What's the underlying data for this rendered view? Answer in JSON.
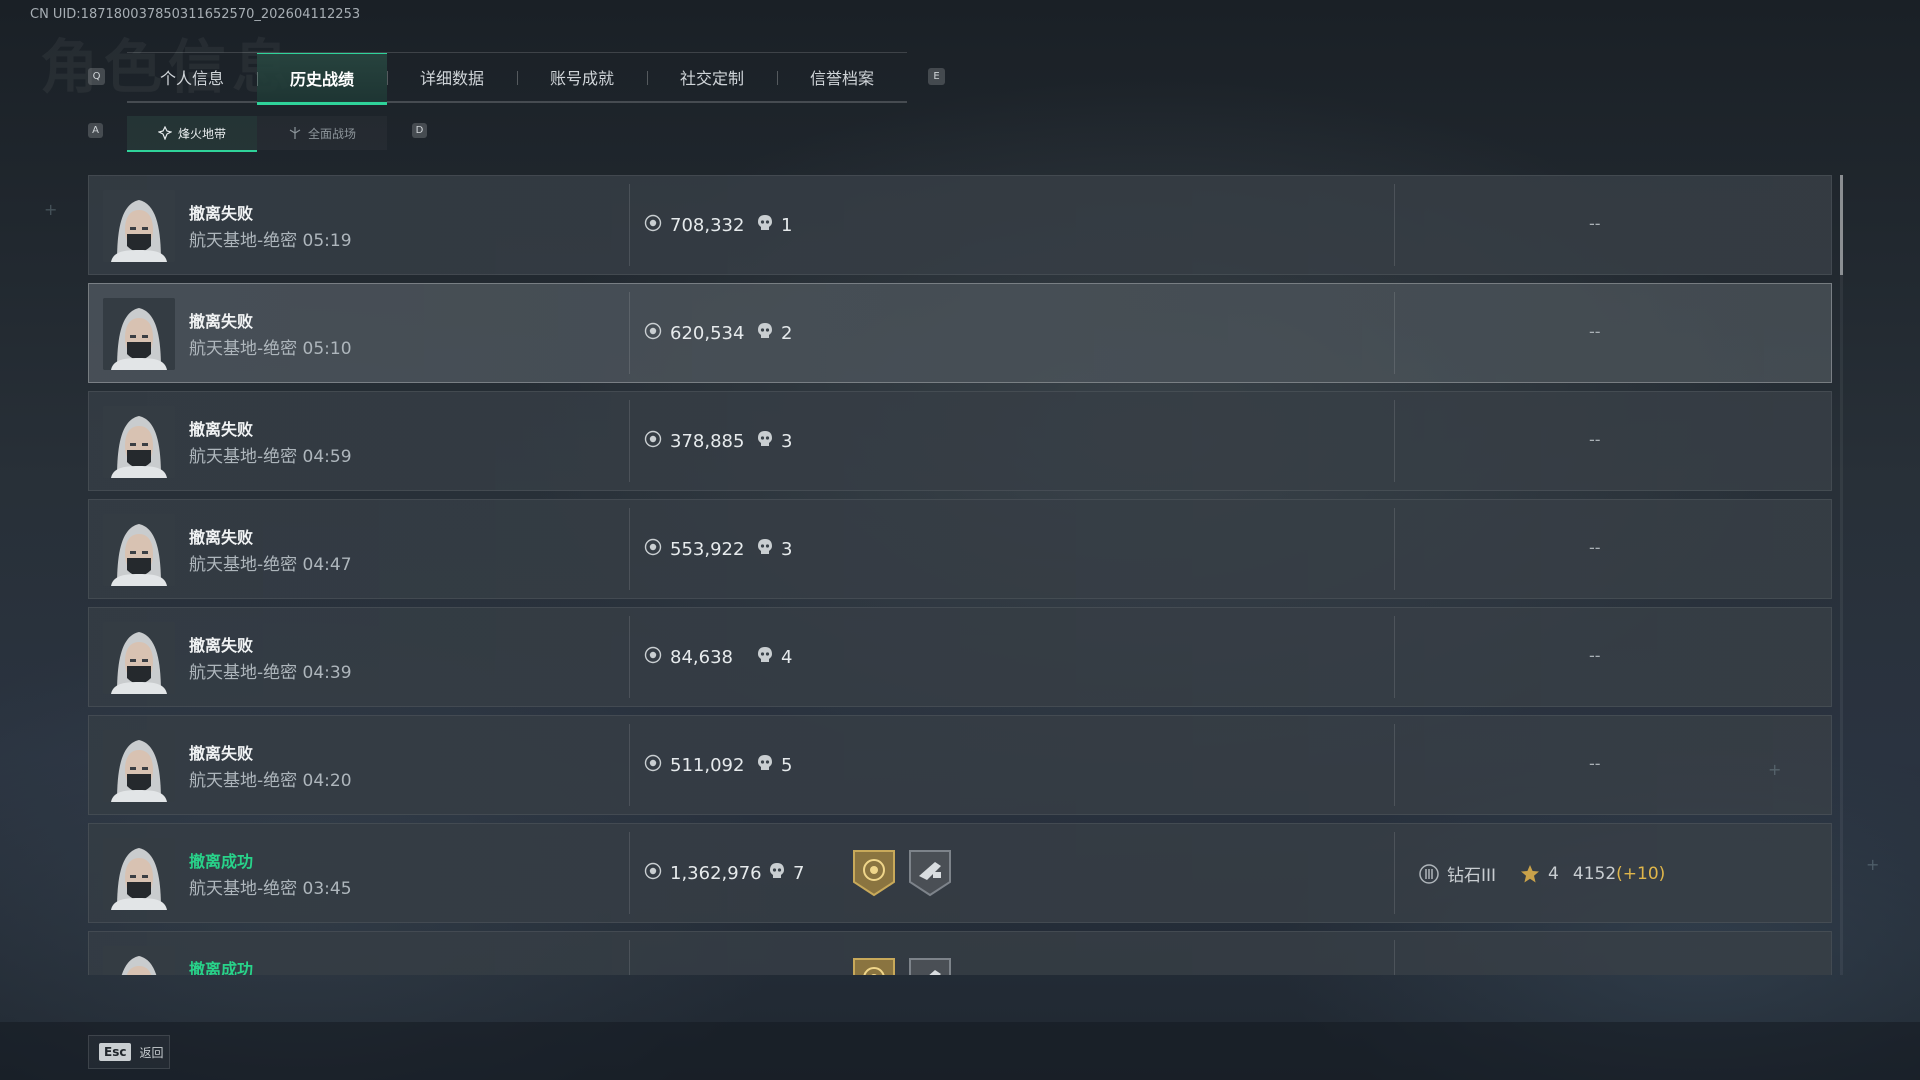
{
  "bg_title": "角色信息",
  "uid": "CN UID:187180037850311652570_202604112253",
  "tabs": {
    "prev_key": "Q",
    "next_key": "E",
    "items": [
      {
        "label": "个人信息"
      },
      {
        "label": "历史战绩"
      },
      {
        "label": "详细数据"
      },
      {
        "label": "账号成就"
      },
      {
        "label": "社交定制"
      },
      {
        "label": "信誉档案"
      }
    ],
    "active_index": 1
  },
  "subtabs": {
    "prev_key": "A",
    "next_key": "D",
    "items": [
      {
        "label": "烽火地带",
        "icon": "fire-zone-icon"
      },
      {
        "label": "全面战场",
        "icon": "battlefield-icon"
      }
    ],
    "active_index": 0
  },
  "matches": [
    {
      "status": "撤离失败",
      "map": "航天基地-绝密 05:19",
      "value": "708,332",
      "kills": "1",
      "result_extra": "--"
    },
    {
      "status": "撤离失败",
      "map": "航天基地-绝密 05:10",
      "value": "620,534",
      "kills": "2",
      "result_extra": "--"
    },
    {
      "status": "撤离失败",
      "map": "航天基地-绝密 04:59",
      "value": "378,885",
      "kills": "3",
      "result_extra": "--"
    },
    {
      "status": "撤离失败",
      "map": "航天基地-绝密 04:47",
      "value": "553,922",
      "kills": "3",
      "result_extra": "--"
    },
    {
      "status": "撤离失败",
      "map": "航天基地-绝密 04:39",
      "value": "84,638",
      "kills": "4",
      "result_extra": "--"
    },
    {
      "status": "撤离失败",
      "map": "航天基地-绝密 04:20",
      "value": "511,092",
      "kills": "5",
      "result_extra": "--"
    },
    {
      "status": "撤离成功",
      "map": "航天基地-绝密 03:45",
      "value": "1,362,976",
      "kills": "7",
      "rank": {
        "tier": "钻石III",
        "stars": "4",
        "score": "4152",
        "delta": "(+10)"
      }
    },
    {
      "status": "撤离成功",
      "map": "",
      "value": "",
      "kills": ""
    }
  ],
  "highlighted_row": 1,
  "footer": {
    "key": "Esc",
    "label": "返回"
  },
  "colors": {
    "accent": "#2fd39a",
    "success": "#28d38a",
    "delta": "#e0b64a"
  }
}
